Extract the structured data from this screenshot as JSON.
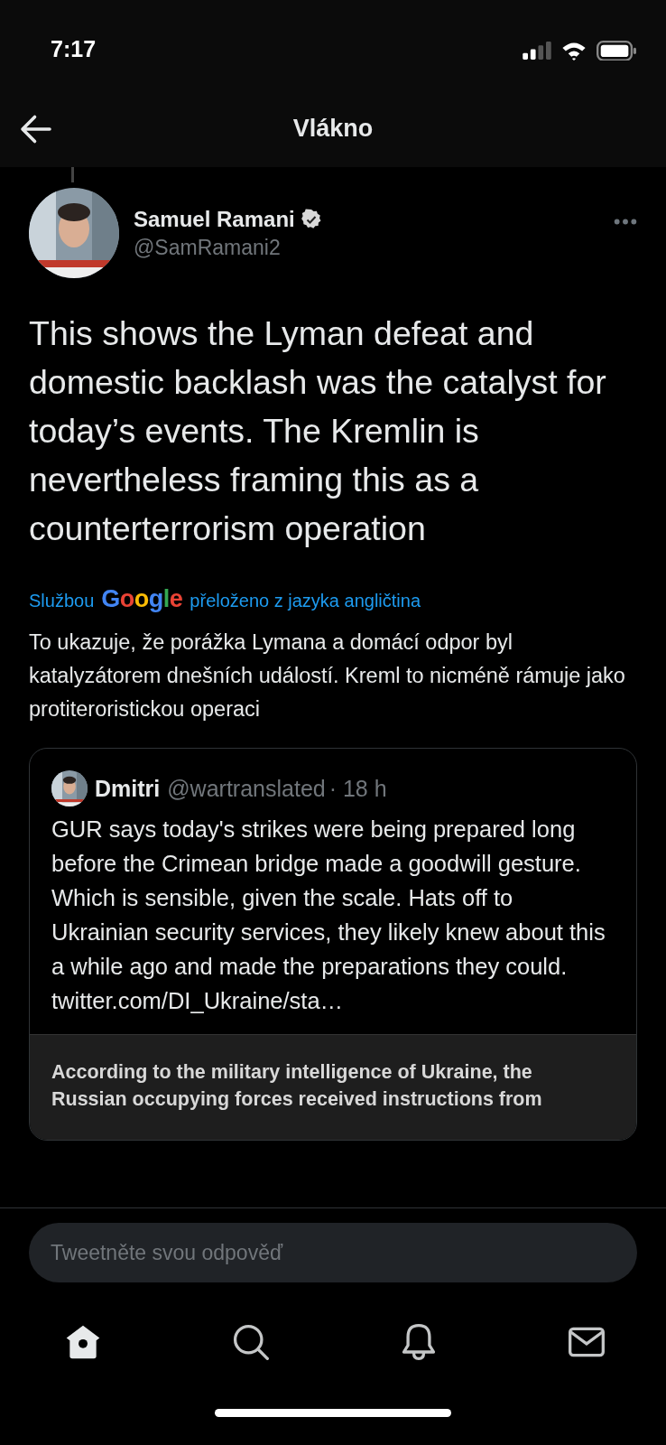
{
  "status_bar": {
    "time": "7:17"
  },
  "header": {
    "title": "Vlákno"
  },
  "tweet": {
    "name": "Samuel Ramani",
    "verified": true,
    "handle": "@SamRamani2",
    "text": "This shows the Lyman defeat and domestic backlash was the catalyst for today’s events. The Kremlin is nevertheless framing this as a counterterrorism operation",
    "translation_note": {
      "before": "Službou",
      "brand": "Google",
      "after": "přeloženo z jazyka angličtina"
    },
    "translated_text": "To ukazuje, že porážka Lymana a domácí odpor byl katalyzátorem dnešních událostí. Kreml to nicméně rámuje jako protiteroristickou operaci",
    "quote": {
      "name": "Dmitri",
      "handle": "@wartranslated",
      "time": "· 18 h",
      "text": "GUR says today's strikes were being prepared long before the Crimean bridge made a goodwill gesture. Which is sensible, given the scale. Hats off to Ukrainian security services, they likely knew about this a while ago and made the preparations they could.",
      "link": "twitter.com/DI_Ukraine/sta…",
      "embedded_text": [
        "According to the military intelligence of Ukraine, the",
        "Russian occupying forces received instructions from"
      ]
    }
  },
  "reply": {
    "placeholder": "Tweetněte svou odpověď"
  },
  "tab_bar": [
    {
      "kind": "home",
      "selected": true
    },
    {
      "kind": "search",
      "selected": false
    },
    {
      "kind": "notifications",
      "selected": false
    },
    {
      "kind": "messages",
      "selected": false
    }
  ]
}
